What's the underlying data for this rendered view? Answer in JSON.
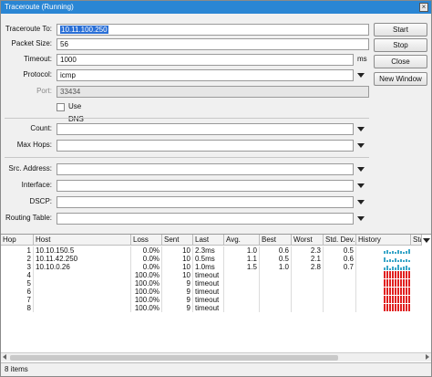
{
  "window": {
    "title": "Traceroute (Running)"
  },
  "form": {
    "traceroute_to": {
      "label": "Traceroute To:",
      "value": "10.11.100.250"
    },
    "packet_size": {
      "label": "Packet Size:",
      "value": "56"
    },
    "timeout": {
      "label": "Timeout:",
      "value": "1000",
      "unit": "ms"
    },
    "protocol": {
      "label": "Protocol:",
      "value": "icmp"
    },
    "port": {
      "label": "Port:",
      "value": "33434"
    },
    "use_dns": {
      "label": "Use DNS",
      "checked": false
    },
    "count": {
      "label": "Count:",
      "value": ""
    },
    "max_hops": {
      "label": "Max Hops:",
      "value": ""
    },
    "src_address": {
      "label": "Src. Address:",
      "value": ""
    },
    "interface": {
      "label": "Interface:",
      "value": ""
    },
    "dscp": {
      "label": "DSCP:",
      "value": ""
    },
    "routing_table": {
      "label": "Routing Table:",
      "value": ""
    }
  },
  "buttons": {
    "start": "Start",
    "stop": "Stop",
    "close": "Close",
    "new_window": "New Window"
  },
  "table": {
    "columns": [
      "Hop",
      "Host",
      "Loss",
      "Sent",
      "Last",
      "Avg.",
      "Best",
      "Worst",
      "Std. Dev.",
      "History",
      "Sta"
    ],
    "rows": [
      {
        "hop": "1",
        "host": "10.10.150.5",
        "loss": "0.0%",
        "sent": "10",
        "last": "2.3ms",
        "avg": "1.0",
        "best": "0.6",
        "worst": "2.3",
        "std": "0.5",
        "history": [
          3,
          4,
          2,
          3,
          2,
          4,
          3,
          2,
          3,
          5
        ],
        "timeout": false
      },
      {
        "hop": "2",
        "host": "10.11.42.250",
        "loss": "0.0%",
        "sent": "10",
        "last": "0.5ms",
        "avg": "1.1",
        "best": "0.5",
        "worst": "2.1",
        "std": "0.6",
        "history": [
          5,
          2,
          3,
          2,
          4,
          2,
          3,
          2,
          3,
          2
        ],
        "timeout": false
      },
      {
        "hop": "3",
        "host": "10.10.0.26",
        "loss": "0.0%",
        "sent": "10",
        "last": "1.0ms",
        "avg": "1.5",
        "best": "1.0",
        "worst": "2.8",
        "std": "0.7",
        "history": [
          3,
          5,
          2,
          4,
          3,
          6,
          3,
          4,
          5,
          3
        ],
        "timeout": false
      },
      {
        "hop": "4",
        "host": "",
        "loss": "100.0%",
        "sent": "10",
        "last": "timeout",
        "avg": "",
        "best": "",
        "worst": "",
        "std": "",
        "history": [],
        "timeout": true
      },
      {
        "hop": "5",
        "host": "",
        "loss": "100.0%",
        "sent": "9",
        "last": "timeout",
        "avg": "",
        "best": "",
        "worst": "",
        "std": "",
        "history": [],
        "timeout": true
      },
      {
        "hop": "6",
        "host": "",
        "loss": "100.0%",
        "sent": "9",
        "last": "timeout",
        "avg": "",
        "best": "",
        "worst": "",
        "std": "",
        "history": [],
        "timeout": true
      },
      {
        "hop": "7",
        "host": "",
        "loss": "100.0%",
        "sent": "9",
        "last": "timeout",
        "avg": "",
        "best": "",
        "worst": "",
        "std": "",
        "history": [],
        "timeout": true
      },
      {
        "hop": "8",
        "host": "",
        "loss": "100.0%",
        "sent": "9",
        "last": "timeout",
        "avg": "",
        "best": "",
        "worst": "",
        "std": "",
        "history": [],
        "timeout": true
      }
    ]
  },
  "status": {
    "items": "8 items"
  },
  "colors": {
    "titlebar": "#2a86d4",
    "history_ok": "#3aa6c8",
    "history_timeout": "#e02020",
    "selection": "#2a6fd6"
  }
}
